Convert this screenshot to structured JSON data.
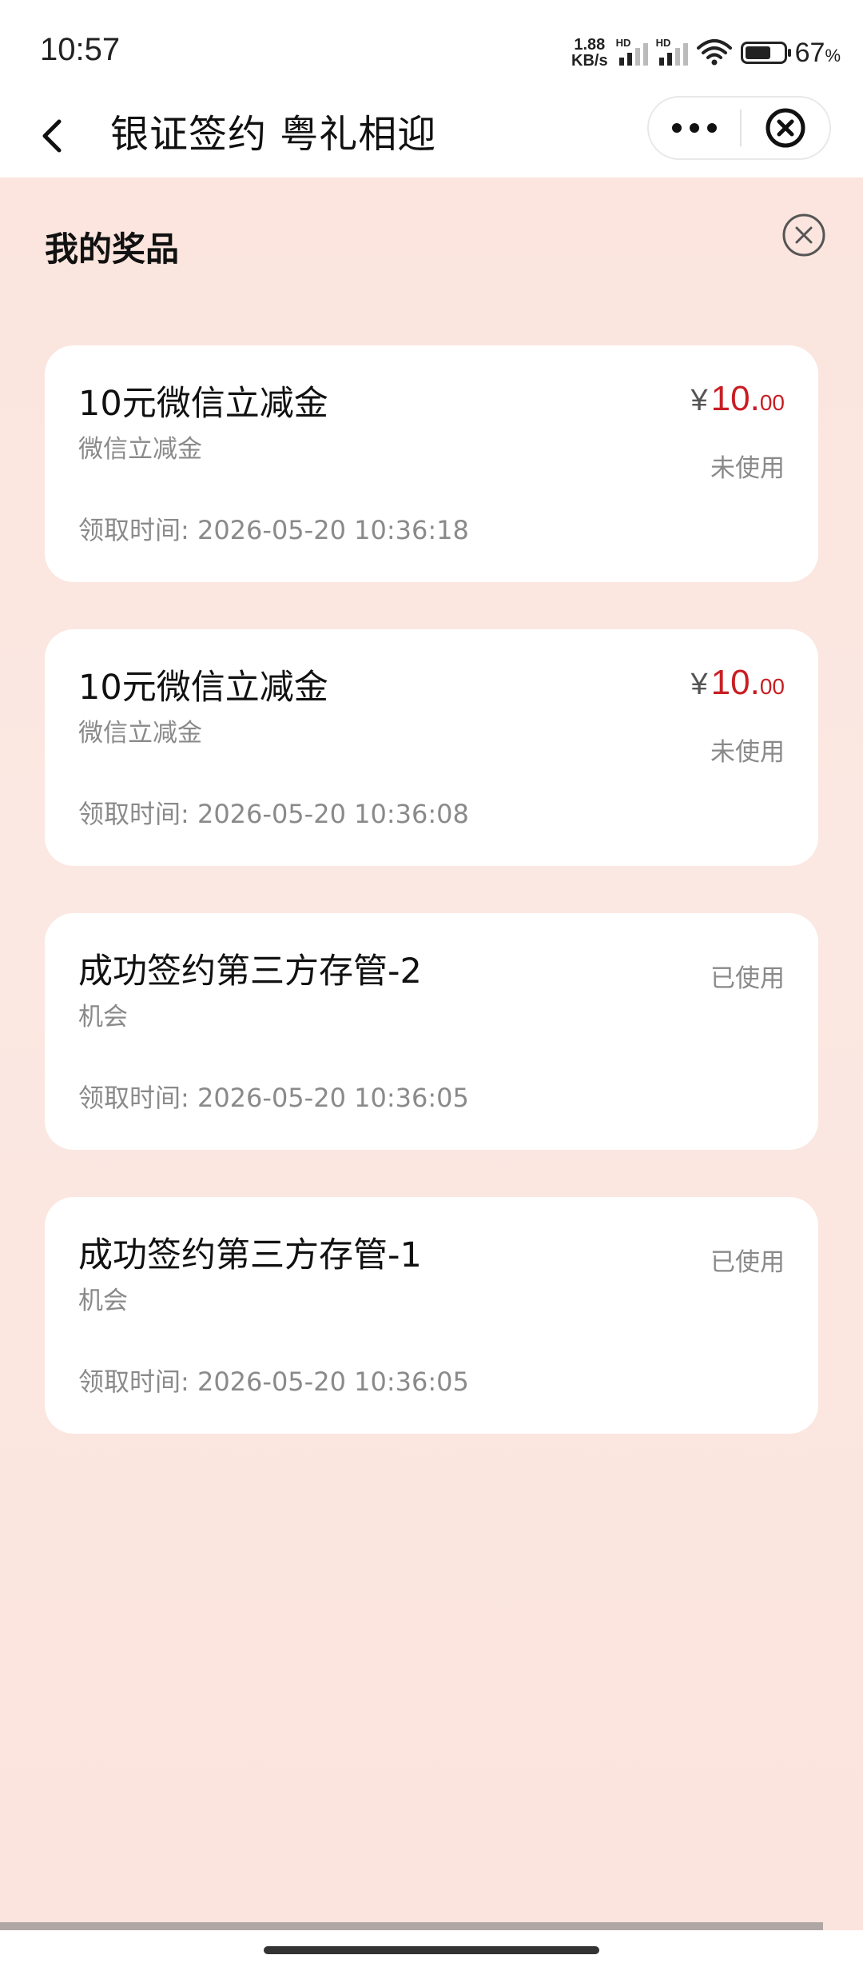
{
  "status_bar": {
    "time": "10:57",
    "speed_value": "1.88",
    "speed_unit": "KB/s",
    "hd_label_1": "HD",
    "hd_label_2": "HD",
    "battery_value": "67",
    "battery_unit": "%",
    "battery_level": 0.67
  },
  "nav": {
    "title": "银证签约 粤礼相迎",
    "back_icon": "chevron-left-icon",
    "more_icon": "more-dots-icon",
    "close_icon": "close-circle-icon"
  },
  "panel": {
    "title": "我的奖品",
    "close_icon": "close-circle-icon"
  },
  "prizes": [
    {
      "name": "10元微信立减金",
      "type": "微信立减金",
      "time_label": "领取时间: 2026-05-20 10:36:18",
      "currency": "¥",
      "amount_int": "10.",
      "amount_dec": "00",
      "status": "未使用"
    },
    {
      "name": "10元微信立减金",
      "type": "微信立减金",
      "time_label": "领取时间: 2026-05-20 10:36:08",
      "currency": "¥",
      "amount_int": "10.",
      "amount_dec": "00",
      "status": "未使用"
    },
    {
      "name": "成功签约第三方存管-2",
      "type": "机会",
      "time_label": "领取时间: 2026-05-20 10:36:05",
      "status": "已使用"
    },
    {
      "name": "成功签约第三方存管-1",
      "type": "机会",
      "time_label": "领取时间: 2026-05-20 10:36:05",
      "status": "已使用"
    }
  ],
  "colors": {
    "accent_red": "#c81e23",
    "panel_bg": "#fbe6df",
    "card_bg": "#ffffff",
    "muted_text": "#8a8a8a"
  }
}
